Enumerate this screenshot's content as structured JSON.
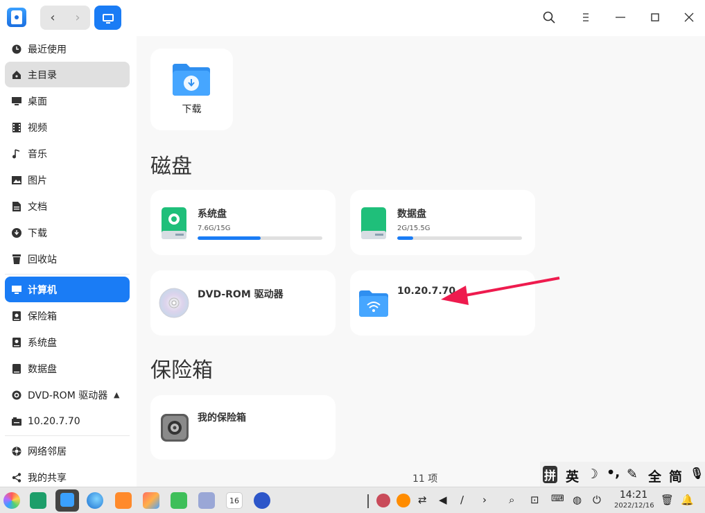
{
  "toolbar": {
    "back_icon": "‹",
    "forward_icon": "›"
  },
  "sidebar": {
    "items": [
      {
        "label": "最近使用",
        "icon": "clock-icon"
      },
      {
        "label": "主目录",
        "icon": "home-icon"
      },
      {
        "label": "桌面",
        "icon": "desktop-icon"
      },
      {
        "label": "视频",
        "icon": "video-icon"
      },
      {
        "label": "音乐",
        "icon": "music-icon"
      },
      {
        "label": "图片",
        "icon": "picture-icon"
      },
      {
        "label": "文档",
        "icon": "document-icon"
      },
      {
        "label": "下载",
        "icon": "download-icon"
      },
      {
        "label": "回收站",
        "icon": "trash-icon"
      },
      {
        "label": "计算机",
        "icon": "computer-icon"
      },
      {
        "label": "保险箱",
        "icon": "vault-icon"
      },
      {
        "label": "系统盘",
        "icon": "disk-icon"
      },
      {
        "label": "数据盘",
        "icon": "disk-icon"
      },
      {
        "label": "DVD-ROM 驱动器",
        "icon": "disc-icon"
      },
      {
        "label": "10.20.7.70",
        "icon": "network-drive-icon"
      },
      {
        "label": "网络邻居",
        "icon": "network-icon"
      },
      {
        "label": "我的共享",
        "icon": "share-icon"
      }
    ],
    "eject_icon": "▲"
  },
  "main": {
    "download_folder": {
      "label": "下载"
    },
    "disks_title": "磁盘",
    "system_disk": {
      "name": "系统盘",
      "size": "7.6G/15G",
      "used_fraction": 0.507
    },
    "data_disk": {
      "name": "数据盘",
      "size": "2G/15.5G",
      "used_fraction": 0.129
    },
    "dvd": {
      "name": "DVD-ROM 驱动器"
    },
    "network_share": {
      "name": "10.20.7.70"
    },
    "vault_title": "保险箱",
    "vault": {
      "name": "我的保险箱"
    },
    "status": "11 项"
  },
  "ime": {
    "pin": "拼",
    "en": "英",
    "moon": "☽",
    "punct": "•,",
    "pen": "✎",
    "full": "全",
    "jian": "简",
    "mic": "🎙"
  },
  "taskbar": {
    "time": "14:21",
    "date": "2022/12/16",
    "calendar_day": "16"
  },
  "colors": {
    "accent": "#1a7cf5",
    "arrow": "#ee1b4e",
    "disk_green": "#1fbf7a"
  }
}
